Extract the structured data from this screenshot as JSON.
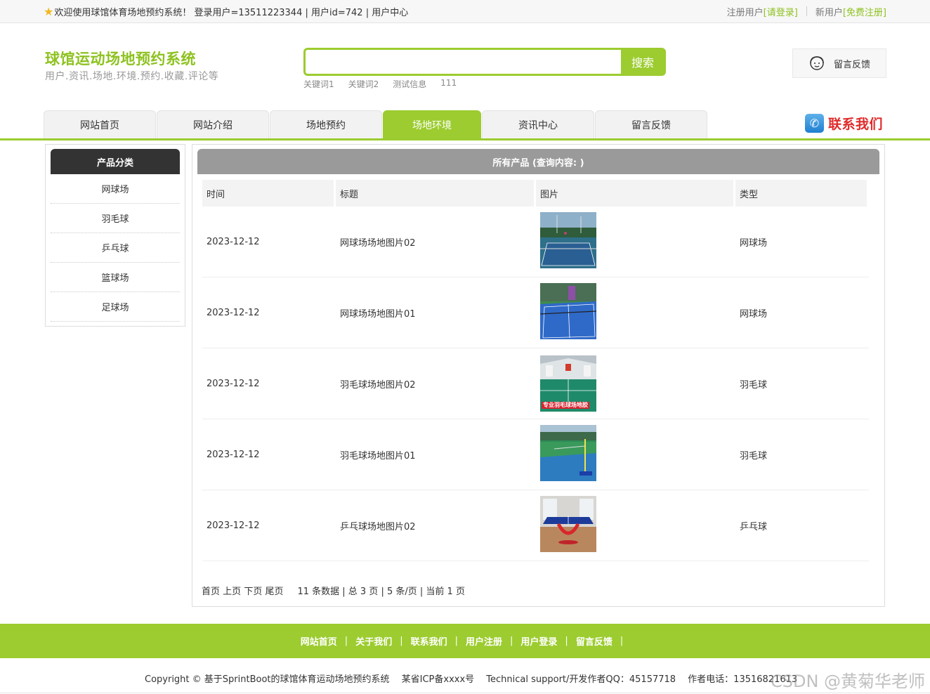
{
  "topbar": {
    "welcome": "欢迎使用球馆体育场地预约系统！ 登录用户=13511223344 | 用户id=742 | 用户中心",
    "reg_user_label": "注册用户",
    "login_link": "[请登录]",
    "new_user_label": "新用户",
    "register_link": "[免费注册]"
  },
  "header": {
    "title": "球馆运动场地预约系统",
    "subtitle": "用户.资讯.场地.环境.预约.收藏.评论等",
    "search_button": "搜索",
    "search_value": "",
    "keywords": [
      "关键词1",
      "关键词2",
      "测试信息",
      "111"
    ],
    "feedback_label": "留言反馈"
  },
  "nav": {
    "tabs": [
      {
        "label": "网站首页",
        "active": false
      },
      {
        "label": "网站介绍",
        "active": false
      },
      {
        "label": "场地预约",
        "active": false
      },
      {
        "label": "场地环境",
        "active": true
      },
      {
        "label": "资讯中心",
        "active": false
      },
      {
        "label": "留言反馈",
        "active": false
      }
    ],
    "contact_label": "联系我们"
  },
  "sidebar": {
    "title": "产品分类",
    "items": [
      "网球场",
      "羽毛球",
      "乒乓球",
      "篮球场",
      "足球场"
    ]
  },
  "main": {
    "title": "所有产品 (查询内容: )",
    "columns": [
      "时间",
      "标题",
      "图片",
      "类型"
    ],
    "rows": [
      {
        "time": "2023-12-12",
        "title": "网球场场地图片02",
        "type": "网球场",
        "image": "tennis-court-night-image"
      },
      {
        "time": "2023-12-12",
        "title": "网球场场地图片01",
        "type": "网球场",
        "image": "tennis-court-blue-image"
      },
      {
        "time": "2023-12-12",
        "title": "羽毛球场地图片02",
        "type": "羽毛球",
        "image": "badminton-hall-image",
        "image_caption": "专业羽毛球场地胶"
      },
      {
        "time": "2023-12-12",
        "title": "羽毛球场地图片01",
        "type": "羽毛球",
        "image": "badminton-outdoor-image"
      },
      {
        "time": "2023-12-12",
        "title": "乒乓球场地图片02",
        "type": "乒乓球",
        "image": "ping-pong-table-image"
      }
    ],
    "pager": {
      "links": [
        "首页",
        "上页",
        "下页",
        "尾页"
      ],
      "info": "11 条数据 | 总 3 页 | 5 条/页 | 当前 1 页"
    }
  },
  "footer": {
    "links": [
      "网站首页",
      "关于我们",
      "联系我们",
      "用户注册",
      "用户登录",
      "留言反馈"
    ],
    "copyright": "Copyright © 基于SprintBoot的球馆体育运动场地预约系统　 某省ICP备xxxx号　 Technical support/开发作者QQ：45157718　 作者电话：13516821613",
    "watermark": "CSDN @黄菊华老师"
  },
  "colors": {
    "accent": "#9ccc2f",
    "title_green": "#8dc21f",
    "contact_red": "#e02b2b",
    "dark_header": "#333333",
    "grey_header": "#9a9a9a"
  }
}
